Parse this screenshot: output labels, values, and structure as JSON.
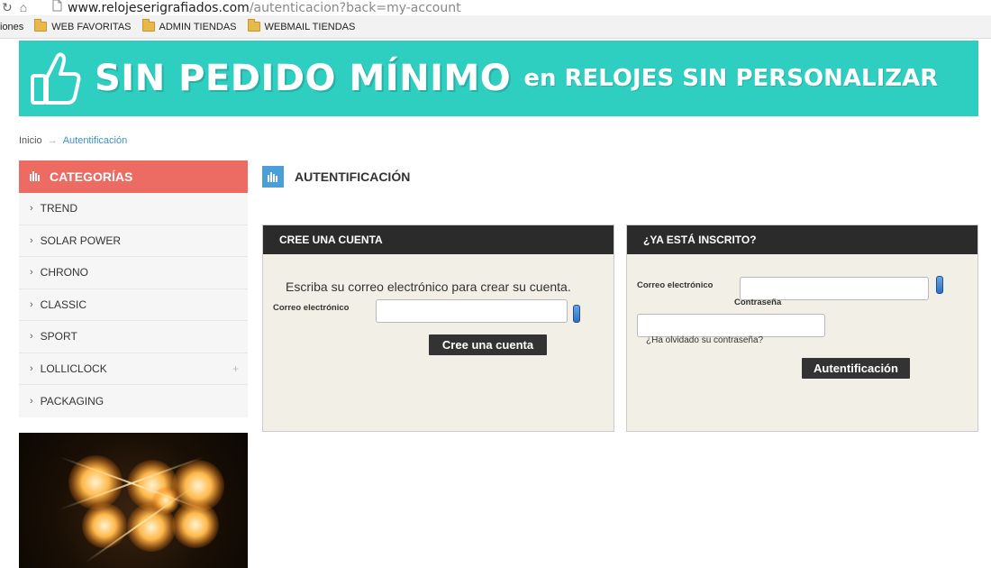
{
  "browser": {
    "url_host": "www.relojeserigrafiados.com",
    "url_path": "/autenticacion?back=my-account",
    "bookmarks": [
      {
        "label": "iones"
      },
      {
        "label": "WEB FAVORITAS"
      },
      {
        "label": "ADMIN TIENDAS"
      },
      {
        "label": "WEBMAIL TIENDAS"
      }
    ]
  },
  "banner": {
    "main": "SIN PEDIDO MÍNIMO",
    "secondary": "en RELOJES SIN PERSONALIZAR",
    "color": "#2ecec0"
  },
  "breadcrumb": {
    "home": "Inicio",
    "separator": "→",
    "current": "Autentificación"
  },
  "sidebar": {
    "title": "CATEGORÍAS",
    "items": [
      {
        "label": "TREND"
      },
      {
        "label": "SOLAR POWER"
      },
      {
        "label": "CHRONO"
      },
      {
        "label": "CLASSIC"
      },
      {
        "label": "SPORT"
      },
      {
        "label": "LOLLICLOCK",
        "expand": "+"
      },
      {
        "label": "PACKAGING"
      }
    ]
  },
  "page": {
    "title": "AUTENTIFICACIÓN"
  },
  "create_account": {
    "header": "CREE UNA CUENTA",
    "description": "Escriba su correo electrónico para crear su cuenta.",
    "email_label": "Correo electrónico",
    "email_value": "",
    "button": "Cree una cuenta"
  },
  "login": {
    "header": "¿YA ESTÁ INSCRITO?",
    "email_label": "Correo electrónico",
    "email_value": "",
    "password_label": "Contraseña",
    "password_value": "",
    "forgot": "¿Ha olvidado su contraseña?",
    "button": "Autentificación"
  },
  "colors": {
    "category_header": "#ec6b62",
    "panel_header": "#2b2b2b",
    "panel_bg": "#f1efe6",
    "accent_blue": "#4a9fd8"
  }
}
